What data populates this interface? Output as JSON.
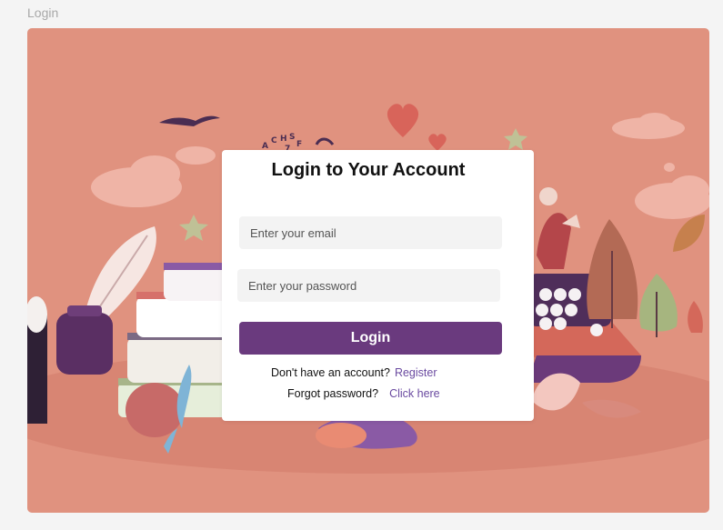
{
  "page": {
    "label": "Login"
  },
  "login_card": {
    "title": "Login to Your Account",
    "email_placeholder": "Enter your email",
    "password_placeholder": "Enter your password",
    "login_button": "Login",
    "register_prompt": "Don't have an account?",
    "register_link": "Register",
    "forgot_prompt": "Forgot password?",
    "forgot_link": "Click here"
  },
  "colors": {
    "background_illustration": "#e0927f",
    "primary_button": "#6a3a7e",
    "link": "#6a4aa0"
  },
  "illustration": {
    "icon": "library-reading-illustration"
  }
}
